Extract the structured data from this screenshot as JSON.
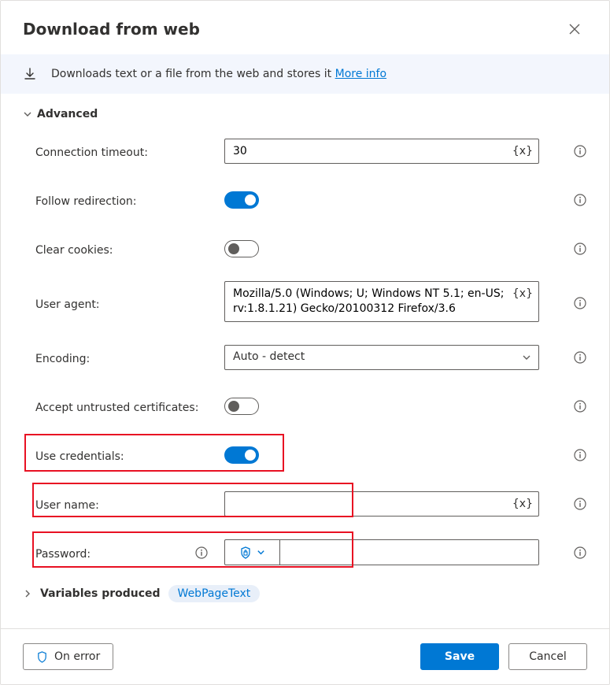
{
  "dialog": {
    "title": "Download from web",
    "banner_text": "Downloads text or a file from the web and stores it ",
    "banner_link": "More info"
  },
  "sections": {
    "advanced": "Advanced",
    "variables": "Variables produced"
  },
  "fields": {
    "timeout_label": "Connection timeout:",
    "timeout_value": "30",
    "follow_label": "Follow redirection:",
    "clear_label": "Clear cookies:",
    "ua_label": "User agent:",
    "ua_value": "Mozilla/5.0 (Windows; U; Windows NT 5.1; en-US; rv:1.8.1.21) Gecko/20100312 Firefox/3.6",
    "encoding_label": "Encoding:",
    "encoding_value": "Auto - detect",
    "accept_label": "Accept untrusted certificates:",
    "creds_label": "Use credentials:",
    "username_label": "User name:",
    "username_value": "",
    "password_label": "Password:",
    "password_value": ""
  },
  "variables": {
    "pill": "WebPageText"
  },
  "footer": {
    "on_error": "On error",
    "save": "Save",
    "cancel": "Cancel"
  },
  "badges": {
    "fx": "{x}"
  }
}
